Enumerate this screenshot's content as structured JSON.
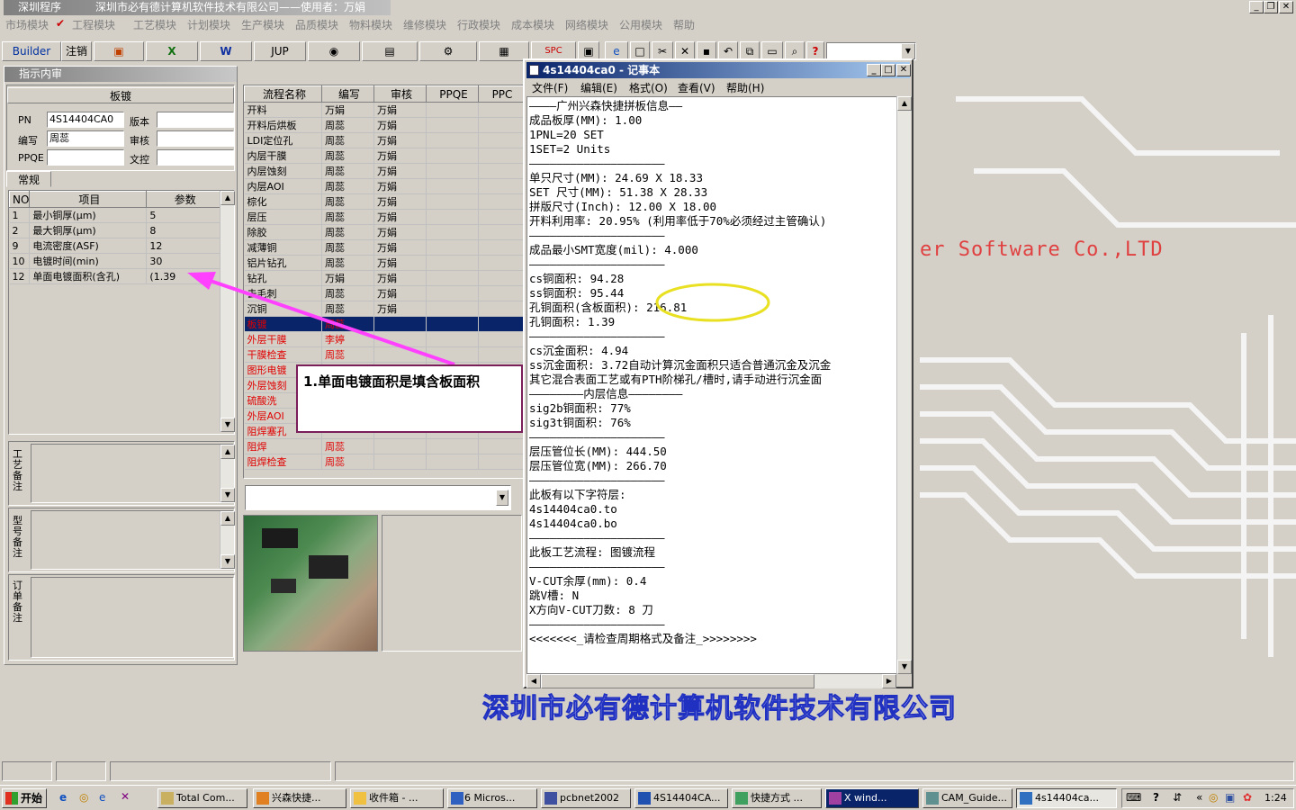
{
  "window": {
    "app_name": "深圳程序",
    "title": "深圳市必有德计算机软件技术有限公司——使用者：万娟"
  },
  "menu": [
    "市场模块",
    "工程模块",
    "工艺模块",
    "计划模块",
    "生产模块",
    "品质模块",
    "物料模块",
    "维修模块",
    "行政模块",
    "成本模块",
    "网络模块",
    "公用模块",
    "帮助"
  ],
  "toolbar": {
    "builder": "Builder",
    "logout": "注销",
    "jup": "JUP",
    "spc": "SPC"
  },
  "left_panel": {
    "title": "指示内审",
    "section_label": "板镀",
    "pn_label": "PN",
    "pn_value": "4S14404CA0",
    "version_label": "版本",
    "editor_label": "编写",
    "editor_value": "周蕊",
    "reviewer_label": "审核",
    "ppqe_label": "PPQE",
    "writer_label": "文控",
    "tab_general": "常规",
    "param_headers": [
      "NO",
      "项目",
      "参数"
    ],
    "params": [
      {
        "no": "1",
        "item": "最小铜厚(μm)",
        "value": "5"
      },
      {
        "no": "2",
        "item": "最大铜厚(μm)",
        "value": "8"
      },
      {
        "no": "9",
        "item": "电流密度(ASF)",
        "value": "12"
      },
      {
        "no": "10",
        "item": "电镀时间(min)",
        "value": "30"
      },
      {
        "no": "12",
        "item": "单面电镀面积(含孔)",
        "value": "(1.39"
      }
    ],
    "note_process": "工艺备注",
    "note_model": "型号备注",
    "note_order": "订单备注"
  },
  "flow_table": {
    "headers": [
      "流程名称",
      "编写",
      "审核",
      "PPQE",
      "PPC"
    ],
    "rows": [
      {
        "name": "开料",
        "author": "万娟",
        "reviewer": "万娟",
        "red": false
      },
      {
        "name": "开料后烘板",
        "author": "周蕊",
        "reviewer": "万娟",
        "red": false
      },
      {
        "name": "LDI定位孔",
        "author": "周蕊",
        "reviewer": "万娟",
        "red": false
      },
      {
        "name": "内层干膜",
        "author": "周蕊",
        "reviewer": "万娟",
        "red": false
      },
      {
        "name": "内层蚀刻",
        "author": "周蕊",
        "reviewer": "万娟",
        "red": false
      },
      {
        "name": "内层AOI",
        "author": "周蕊",
        "reviewer": "万娟",
        "red": false
      },
      {
        "name": "棕化",
        "author": "周蕊",
        "reviewer": "万娟",
        "red": false
      },
      {
        "name": "层压",
        "author": "周蕊",
        "reviewer": "万娟",
        "red": false
      },
      {
        "name": "除胶",
        "author": "周蕊",
        "reviewer": "万娟",
        "red": false
      },
      {
        "name": "减薄铜",
        "author": "周蕊",
        "reviewer": "万娟",
        "red": false
      },
      {
        "name": "铝片钻孔",
        "author": "周蕊",
        "reviewer": "万娟",
        "red": false
      },
      {
        "name": "钻孔",
        "author": "万娟",
        "reviewer": "万娟",
        "red": false
      },
      {
        "name": "去毛刺",
        "author": "周蕊",
        "reviewer": "万娟",
        "red": false
      },
      {
        "name": "沉铜",
        "author": "周蕊",
        "reviewer": "万娟",
        "red": false
      },
      {
        "name": "板镀",
        "author": "周蕊",
        "reviewer": "",
        "red": true,
        "selected": true
      },
      {
        "name": "外层干膜",
        "author": "李婷",
        "reviewer": "",
        "red": true
      },
      {
        "name": "干膜检查",
        "author": "周蕊",
        "reviewer": "",
        "red": true
      },
      {
        "name": "图形电镀",
        "author": "",
        "reviewer": "",
        "red": true
      },
      {
        "name": "外层蚀刻",
        "author": "",
        "reviewer": "",
        "red": true
      },
      {
        "name": "硫酸洗",
        "author": "",
        "reviewer": "",
        "red": true
      },
      {
        "name": "外层AOI",
        "author": "",
        "reviewer": "",
        "red": true
      },
      {
        "name": "阻焊塞孔",
        "author": "",
        "reviewer": "",
        "red": true
      },
      {
        "name": "阻焊",
        "author": "周蕊",
        "reviewer": "",
        "red": true
      },
      {
        "name": "阻焊检查",
        "author": "周蕊",
        "reviewer": "",
        "red": true
      }
    ]
  },
  "notepad": {
    "title": "4s14404ca0 - 记事本",
    "menu": [
      "文件(F)",
      "编辑(E)",
      "格式(O)",
      "查看(V)",
      "帮助(H)"
    ],
    "lines": [
      "————广州兴森快捷拼板信息——",
      "成品板厚(MM): 1.00",
      "1PNL=20 SET",
      "1SET=2 Units",
      "————————————————————",
      "单只尺寸(MM): 24.69 X 18.33",
      "SET 尺寸(MM): 51.38 X 28.33",
      "拼版尺寸(Inch): 12.00 X 18.00",
      "开料利用率: 20.95% (利用率低于70%必须经过主管确认)",
      "————————————————————",
      "成品最小SMT宽度(mil): 4.000",
      "————————————————————",
      "cs铜面积: 94.28",
      "ss铜面积: 95.44",
      "孔铜面积(含板面积): 216.81",
      "孔铜面积: 1.39",
      "————————————————————",
      "cs沉金面积: 4.94",
      "ss沉金面积: 3.72自动计算沉金面积只适合普通沉金及沉金",
      "其它混合表面工艺或有PTH阶梯孔/槽时,请手动进行沉金面",
      "————————内层信息————————",
      "sig2b铜面积: 77%",
      "sig3t铜面积: 76%",
      "————————————————————",
      "层压管位长(MM): 444.50",
      "层压管位宽(MM): 266.70",
      "————————————————————",
      "此板有以下字符层:",
      "4s14404ca0.to",
      "4s14404ca0.bo",
      "————————————————————",
      "此板工艺流程: 图镀流程",
      "————————————————————",
      "V-CUT余厚(mm): 0.4",
      "跳V槽: N",
      "X方向V-CUT刀数: 8 刀",
      "————————————————————",
      "<<<<<<<_请检查周期格式及备注_>>>>>>>>"
    ]
  },
  "desktop": {
    "brand_partial": "er Software Co.,LTD",
    "company_banner": "深圳市必有德计算机软件技术有限公司"
  },
  "callout": {
    "text": "1.单面电镀面积是填含板面积"
  },
  "taskbar": {
    "start": "开始",
    "tasks": [
      "Total Com...",
      "兴森快捷...",
      "收件箱 - ...",
      "6 Micros...",
      "pcbnet2002",
      "4S14404CA...",
      "快捷方式 ...",
      "X wind...",
      "CAM_Guide...",
      "4s14404ca..."
    ],
    "clock": "1:24"
  }
}
